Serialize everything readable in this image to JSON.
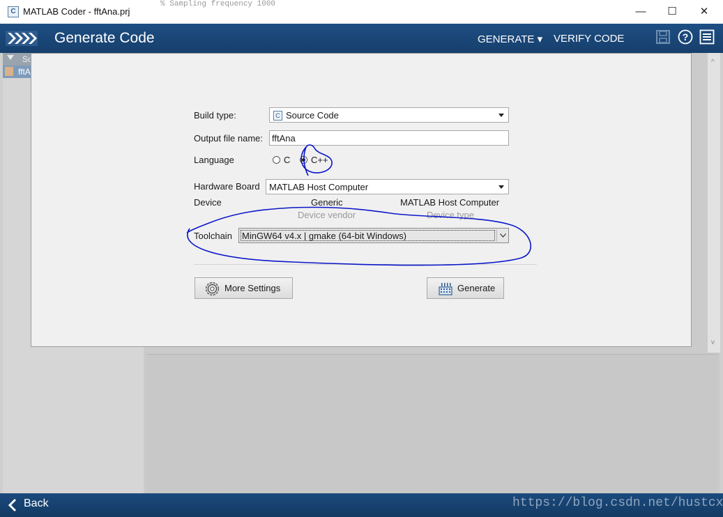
{
  "window": {
    "title": "MATLAB Coder - fftAna.prj",
    "app_icon_glyph": "C",
    "minimize": "—",
    "maximize": "☐",
    "close": "✕"
  },
  "header": {
    "title": "Generate Code",
    "tab_generate": "GENERATE ▾",
    "tab_verify": "VERIFY CODE",
    "icons": [
      "save-icon",
      "help-icon",
      "menu-icon"
    ]
  },
  "background": {
    "code_line": "% Sampling frequency  1000",
    "left_items": [
      "So",
      "fftA"
    ]
  },
  "form": {
    "build_type_label": "Build type:",
    "build_type_value": "Source Code",
    "build_type_icon": "C",
    "output_file_label": "Output file name:",
    "output_file_value": "fftAna",
    "language_label": "Language",
    "language_options": [
      "C",
      "C++"
    ],
    "language_selected": "C++",
    "hardware_board_label": "Hardware Board",
    "hardware_board_value": "MATLAB Host Computer",
    "device_label": "Device",
    "device_vendor_value": "Generic",
    "device_vendor_caption": "Device vendor",
    "device_type_value": "MATLAB Host Computer",
    "device_type_caption": "Device type",
    "toolchain_label": "Toolchain",
    "toolchain_value": "MinGW64 v4.x | gmake (64-bit Windows)"
  },
  "buttons": {
    "more_settings": "More Settings",
    "generate": "Generate"
  },
  "footer": {
    "back": "Back",
    "watermark": "https://blog.csdn.net/hustcx"
  },
  "colors": {
    "header_blue": "#1e4e83",
    "annotation_ink": "#0a16c8"
  }
}
